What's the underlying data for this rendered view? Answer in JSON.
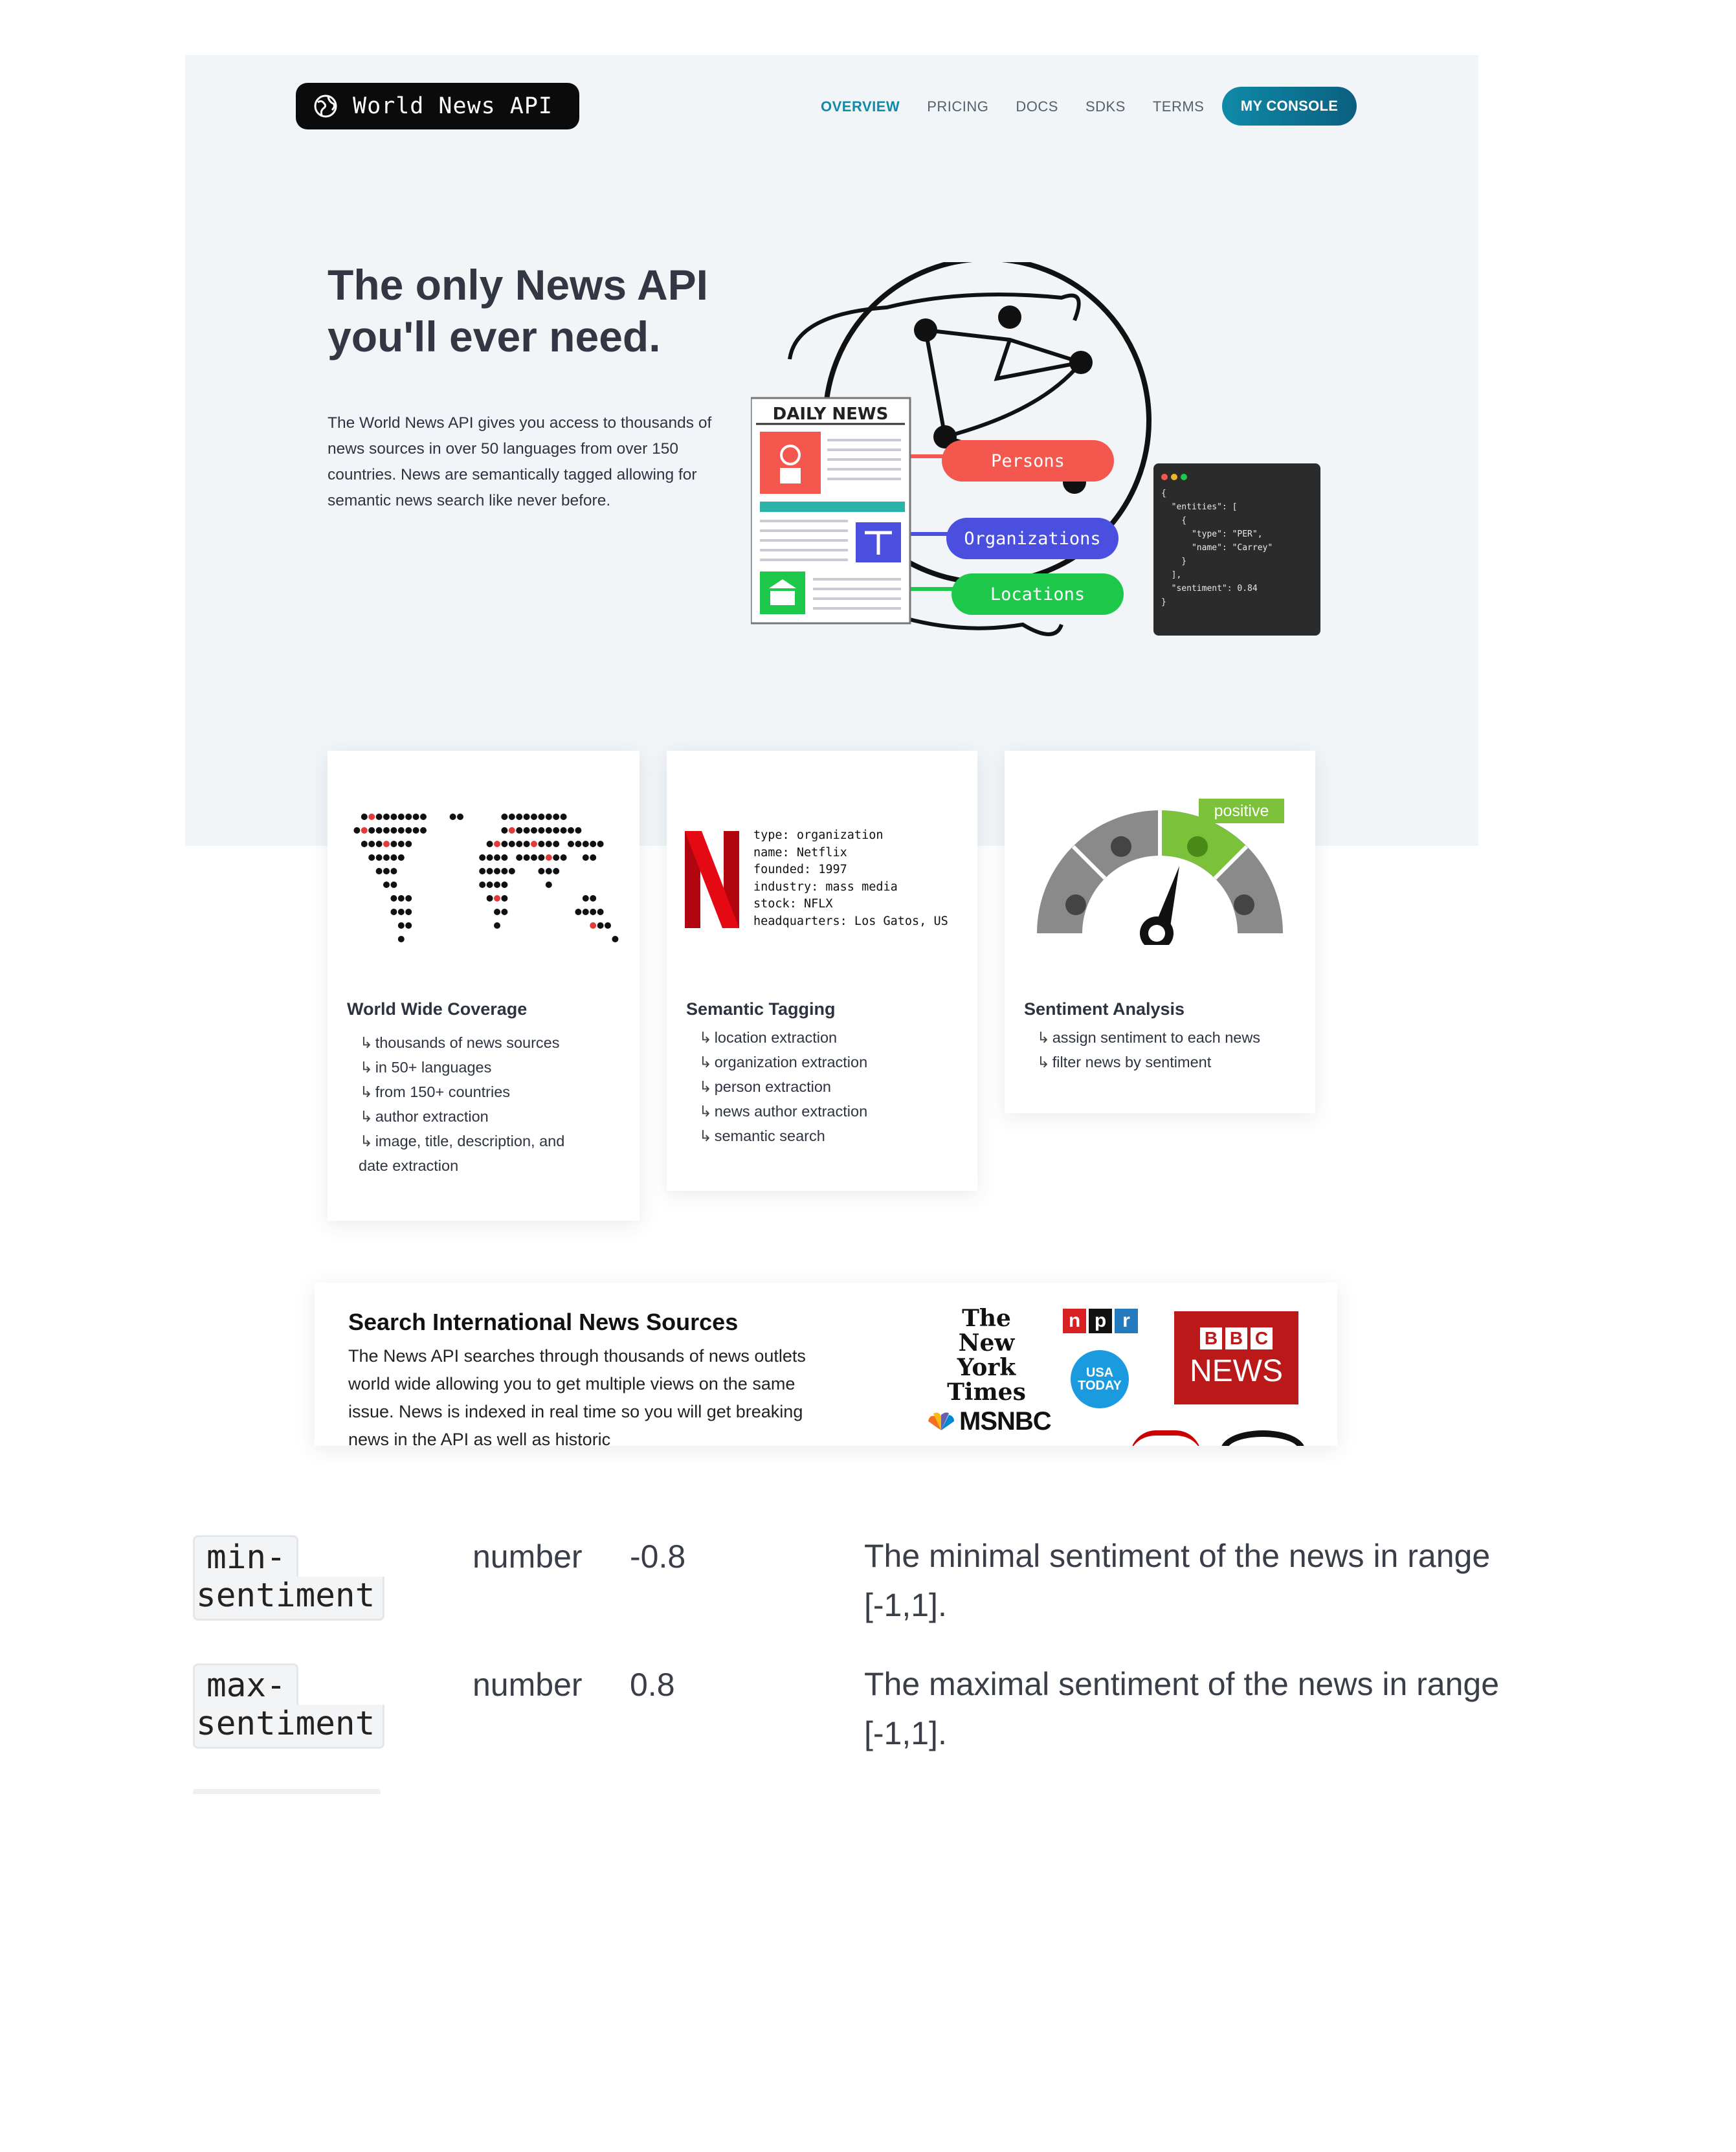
{
  "header": {
    "logo_text": "World News API",
    "nav": [
      {
        "label": "OVERVIEW",
        "active": true
      },
      {
        "label": "PRICING",
        "active": false
      },
      {
        "label": "DOCS",
        "active": false
      },
      {
        "label": "SDKS",
        "active": false
      },
      {
        "label": "TERMS",
        "active": false
      }
    ],
    "console_label": "MY CONSOLE"
  },
  "hero": {
    "title_line1": "The only News API",
    "title_line2": "you'll ever need.",
    "description": "The World News API gives you access to thousands of news sources in over 50 languages from over 150 countries. News are semantically tagged allowing for semantic news search like never before.",
    "newspaper_title": "DAILY NEWS",
    "tags": {
      "persons": "Persons",
      "organizations": "Organizations",
      "locations": "Locations"
    },
    "code_lines": [
      "{",
      "  \"entities\": [",
      "    {",
      "      \"type\": \"PER\",",
      "      \"name\": \"Carrey\"",
      "    }",
      "  ],",
      "  \"sentiment\": 0.84",
      "}"
    ]
  },
  "cards": [
    {
      "title": "World Wide Coverage",
      "items": [
        "thousands of news sources",
        "in 50+ languages",
        "from 150+ countries",
        "author extraction",
        "image, title, description, and",
        "date extraction"
      ]
    },
    {
      "title": "Semantic Tagging",
      "code_lines": [
        "type: organization",
        "name: Netflix",
        "founded: 1997",
        "industry: mass media",
        "stock: NFLX",
        "headquarters: Los Gatos, US"
      ],
      "items": [
        "location extraction",
        "organization extraction",
        "person extraction",
        "news author extraction",
        "semantic search"
      ]
    },
    {
      "title": "Sentiment Analysis",
      "badge": "positive",
      "items": [
        "assign sentiment to each news",
        "filter news by sentiment"
      ]
    }
  ],
  "sources": {
    "title": "Search International News Sources",
    "description": "The News API searches through thousands of news outlets world wide allowing you to get multiple views on the same issue. News is indexed in real time so you will get breaking news in the API as well as historic",
    "logos": {
      "nyt1": "The",
      "nyt2": "New York",
      "nyt3": "Times",
      "npr": [
        "n",
        "p",
        "r"
      ],
      "usa1": "USA",
      "usa2": "TODAY",
      "bbc": [
        "B",
        "B",
        "C"
      ],
      "bbc_news": "NEWS",
      "msnbc": "MSNBC"
    }
  },
  "params": [
    {
      "name_line1": "min-",
      "name_line2": "sentiment",
      "type": "number",
      "example": "-0.8",
      "desc": "The minimal sentiment of the news in range [-1,1]."
    },
    {
      "name_line1": "max-",
      "name_line2": "sentiment",
      "type": "number",
      "example": "0.8",
      "desc": "The maximal sentiment of the news in range [-1,1]."
    }
  ],
  "colors": {
    "accent": "#0f8aa8",
    "persons": "#f4574e",
    "organizations": "#4a4fe0",
    "locations": "#1ec84a",
    "positive": "#7cc13a"
  }
}
